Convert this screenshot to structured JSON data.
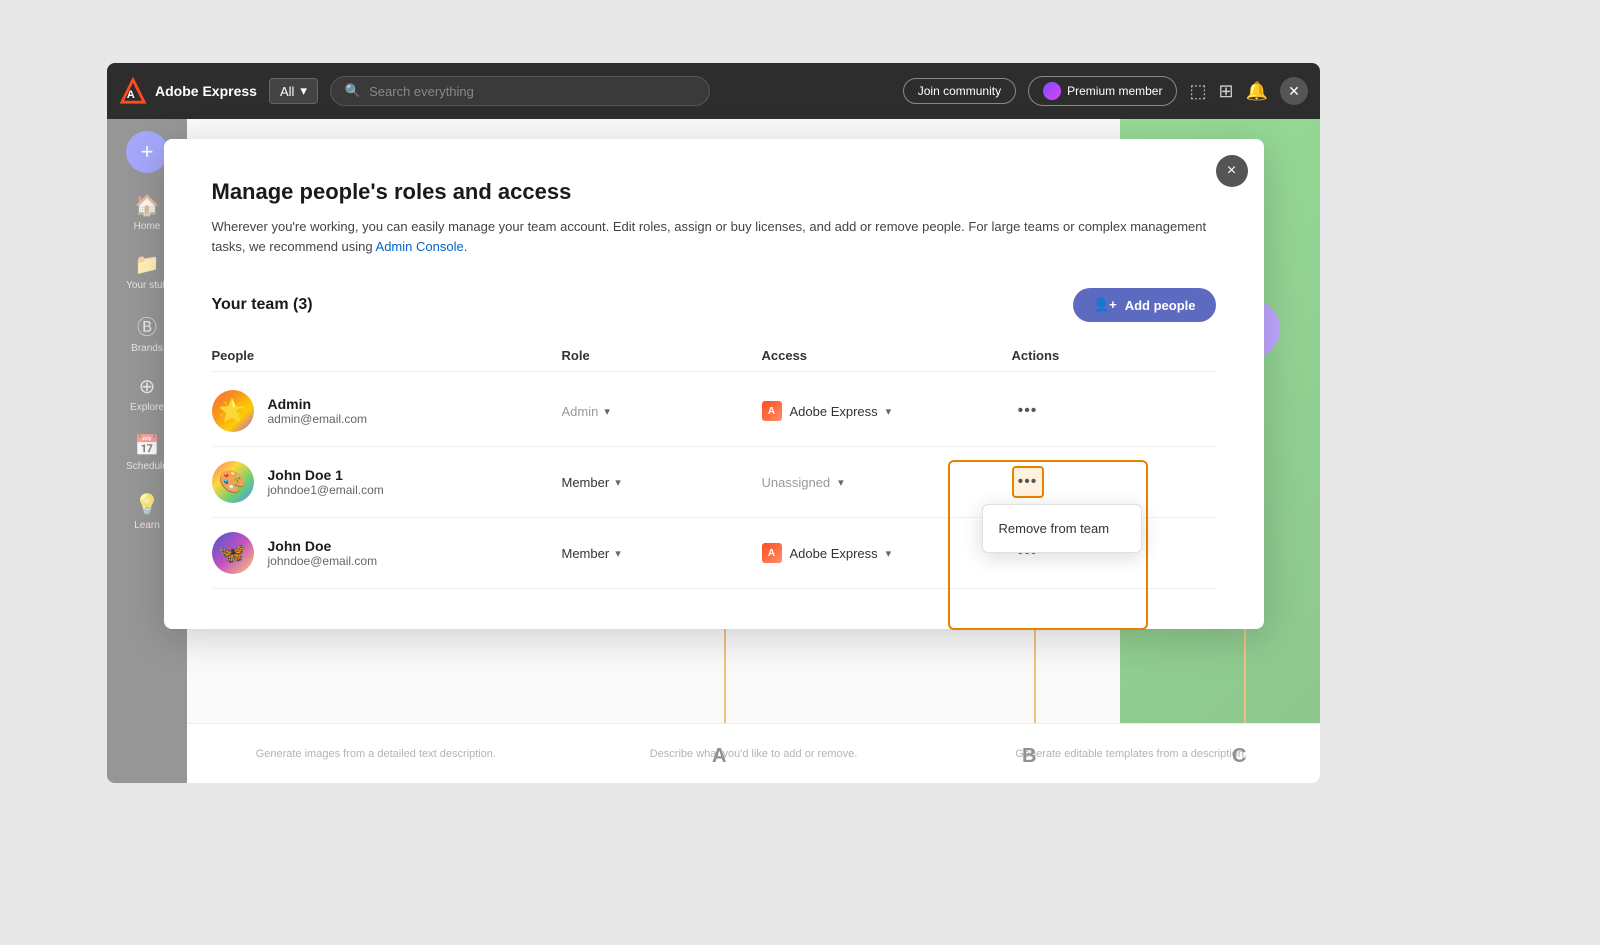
{
  "app": {
    "name": "Adobe Express",
    "header": {
      "dropdown_label": "All",
      "search_placeholder": "Search everything",
      "join_community": "Join community",
      "premium_member": "Premium member"
    }
  },
  "sidebar": {
    "add_label": "+",
    "items": [
      {
        "id": "home",
        "label": "Home",
        "icon": "⌂"
      },
      {
        "id": "your-stuff",
        "label": "Your stuff",
        "icon": "📁"
      },
      {
        "id": "brands",
        "label": "Brands",
        "icon": "Ⓑ"
      },
      {
        "id": "explore",
        "label": "Explore",
        "icon": "⊕"
      },
      {
        "id": "schedule",
        "label": "Schedule",
        "icon": "📅"
      },
      {
        "id": "learn",
        "label": "Learn",
        "icon": "💡"
      }
    ]
  },
  "modal": {
    "title": "Manage people's roles and access",
    "description": "Wherever you're working, you can easily manage your team account. Edit roles, assign or buy licenses, and add or remove people. For large teams or complex management tasks, we recommend using",
    "admin_console_link": "Admin Console",
    "team_title": "Your team (3)",
    "add_people_label": "Add people",
    "close_label": "×",
    "table": {
      "headers": [
        "People",
        "Role",
        "Access",
        "Actions"
      ],
      "rows": [
        {
          "id": "admin",
          "name": "Admin",
          "email": "admin@email.com",
          "role": "Admin",
          "access": "Adobe Express",
          "access_type": "product",
          "avatar_emoji": "🌟"
        },
        {
          "id": "john-doe-1",
          "name": "John Doe 1",
          "email": "johndoe1@email.com",
          "role": "Member",
          "access": "Unassigned",
          "access_type": "unassigned",
          "avatar_emoji": "🎨",
          "show_dropdown": true,
          "dropdown_items": [
            "Remove from team"
          ]
        },
        {
          "id": "john-doe",
          "name": "John Doe",
          "email": "johndoe@email.com",
          "role": "Member",
          "access": "Adobe Express",
          "access_type": "product",
          "avatar_emoji": "🦋"
        }
      ]
    }
  },
  "bottom_bar": {
    "items": [
      "Generate images from a detailed text description.",
      "Describe what you'd like to add or remove.",
      "Generate editable templates from a description."
    ]
  },
  "annotations": {
    "a_label": "A",
    "b_label": "B",
    "c_label": "C"
  }
}
